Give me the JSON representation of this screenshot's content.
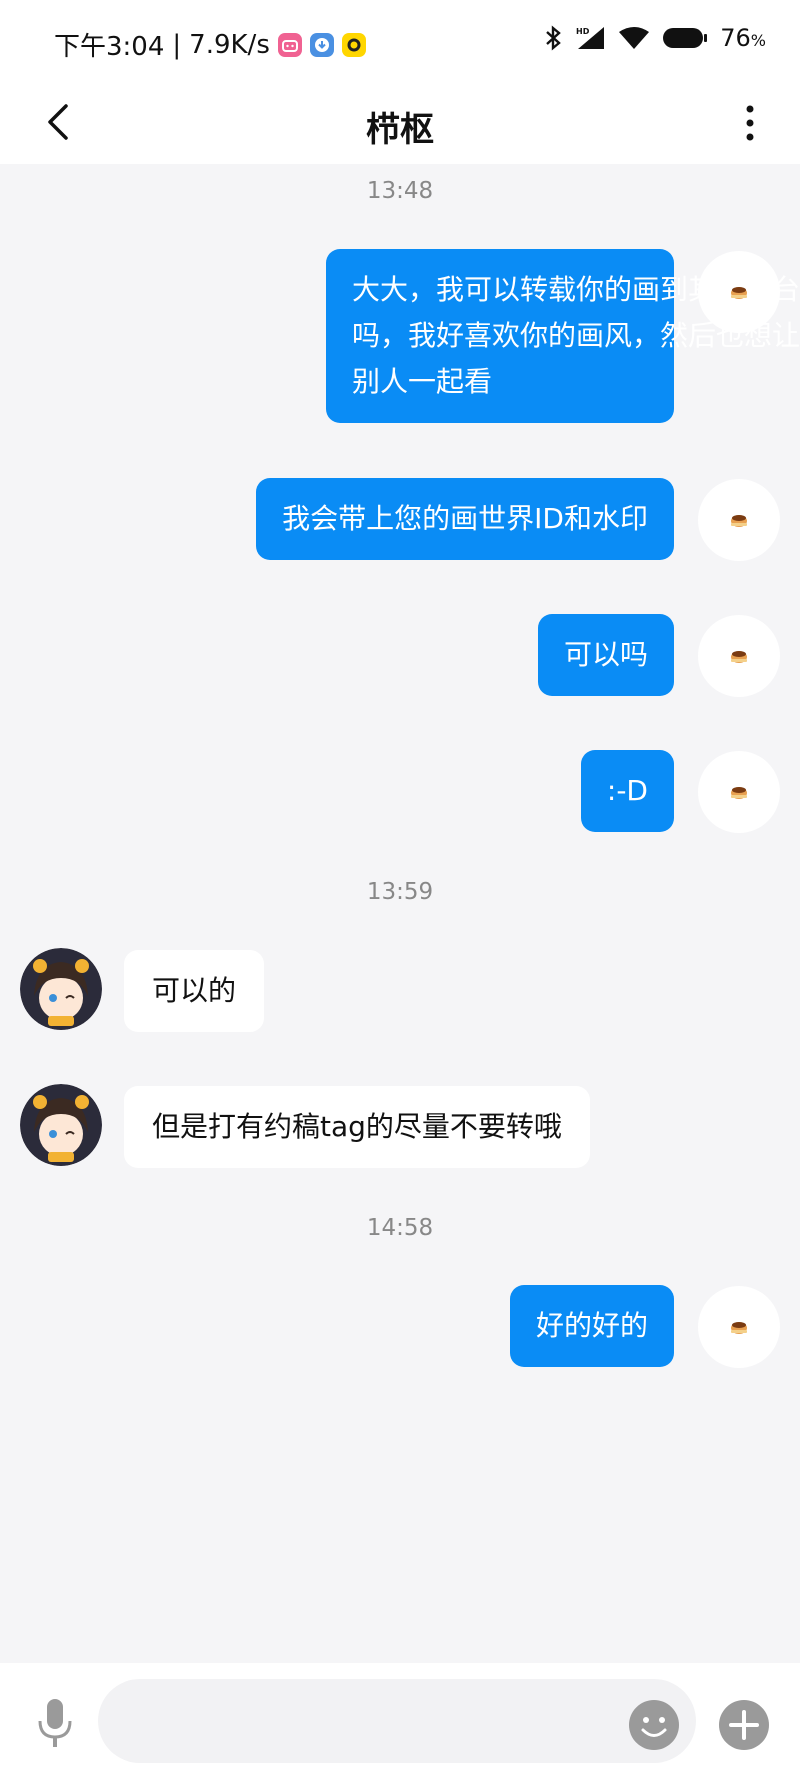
{
  "status_bar": {
    "time": "下午3:04",
    "separator": "|",
    "speed": "7.9K/s",
    "battery": "76",
    "battery_unit": "%",
    "icons": [
      "bilibili-icon",
      "download-icon",
      "yellow-app-icon",
      "bluetooth-icon",
      "hd-signal-icon",
      "wifi-icon",
      "battery-icon"
    ]
  },
  "header": {
    "title": "栉枢",
    "back_icon": "back-chevron-icon",
    "menu_icon": "more-vertical-icon"
  },
  "timestamps": [
    "13:48",
    "13:59",
    "14:58"
  ],
  "messages": [
    {
      "side": "me",
      "lines": [
        "大大，我可以转载你的画到其他平台",
        "吗，我好喜欢你的画风，然后也想让",
        "别人一起看"
      ]
    },
    {
      "side": "me",
      "lines": [
        "我会带上您的画世界ID和水印"
      ]
    },
    {
      "side": "me",
      "lines": [
        "可以吗"
      ]
    },
    {
      "side": "me",
      "lines": [
        ":-D"
      ]
    },
    {
      "side": "them",
      "lines": [
        "可以的"
      ]
    },
    {
      "side": "them",
      "lines": [
        "但是打有约稿tag的尽量不要转哦"
      ]
    },
    {
      "side": "me",
      "lines": [
        "好的好的"
      ]
    }
  ],
  "input_bar": {
    "placeholder": "",
    "mic_icon": "microphone-icon",
    "emoji_icon": "emoji-icon",
    "plus_icon": "plus-icon"
  },
  "colors": {
    "my_bubble": "#0a8cf5",
    "their_bubble": "#ffffff",
    "background": "#f5f5f7",
    "timestamp": "#888888"
  }
}
